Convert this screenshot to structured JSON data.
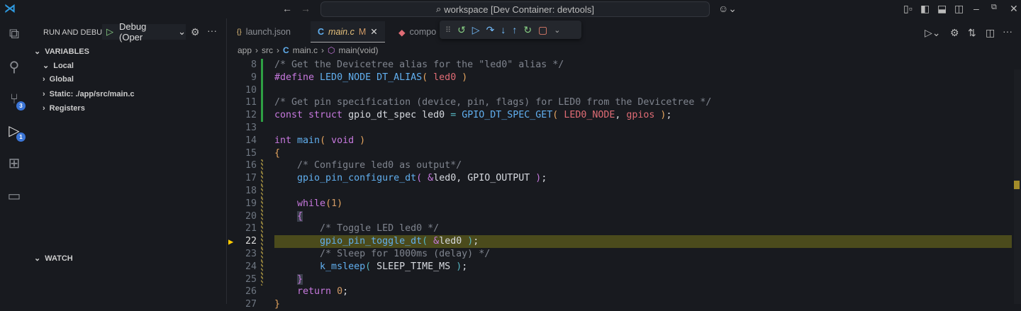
{
  "titlebar": {
    "search_text": "workspace [Dev Container: devtools]",
    "accent": "#2f9ae0"
  },
  "activity": {
    "scm_badge": "3",
    "debug_badge": "1"
  },
  "sidebar": {
    "title": "RUN AND DEBUG",
    "config": "Debug (Oper",
    "variables_label": "VARIABLES",
    "items": [
      {
        "label": "Local",
        "expanded": true
      },
      {
        "label": "Global"
      },
      {
        "label": "Static: ./app/src/main.c"
      },
      {
        "label": "Registers"
      }
    ],
    "watch_label": "WATCH"
  },
  "tabs": [
    {
      "label": "launch.json",
      "icon": "{}"
    },
    {
      "label": "main.c",
      "icon": "C",
      "modified": "M",
      "active": true
    },
    {
      "label": "compo",
      "icon": "docker"
    }
  ],
  "breadcrumb": [
    "app",
    "src",
    "main.c",
    "main(void)"
  ],
  "code": {
    "current_line": 22,
    "lines": [
      {
        "n": "8",
        "t": [
          [
            "cm",
            "/* Get the Devicetree alias for the \"led0\" alias */"
          ]
        ]
      },
      {
        "n": "9",
        "t": [
          [
            "pp",
            "#define "
          ],
          [
            "mac",
            "LED0_NODE DT_ALIAS"
          ],
          [
            "par",
            "( "
          ],
          [
            "arg",
            "led0"
          ],
          [
            "par",
            " )"
          ]
        ]
      },
      {
        "n": "10",
        "t": []
      },
      {
        "n": "11",
        "t": [
          [
            "cm",
            "/* Get pin specification (device, pin, flags) for LED0 from the Devicetree */"
          ]
        ]
      },
      {
        "n": "12",
        "t": [
          [
            "kw",
            "const struct "
          ],
          [
            "id",
            "gpio_dt_spec led0 "
          ],
          [
            "op",
            "= "
          ],
          [
            "mac",
            "GPIO_DT_SPEC_GET"
          ],
          [
            "par",
            "( "
          ],
          [
            "arg",
            "LED0_NODE"
          ],
          [
            "pn",
            ", "
          ],
          [
            "arg",
            "gpios"
          ],
          [
            "par",
            " )"
          ],
          [
            "pn",
            ";"
          ]
        ]
      },
      {
        "n": "13",
        "t": []
      },
      {
        "n": "14",
        "t": [
          [
            "kw",
            "int "
          ],
          [
            "fn",
            "main"
          ],
          [
            "par",
            "( "
          ],
          [
            "kw",
            "void"
          ],
          [
            "par",
            " )"
          ]
        ]
      },
      {
        "n": "15",
        "t": [
          [
            "par",
            "{"
          ]
        ]
      },
      {
        "n": "16",
        "t": [
          [
            "pn",
            "    "
          ],
          [
            "cm",
            "/* Configure led0 as output*/"
          ]
        ]
      },
      {
        "n": "17",
        "t": [
          [
            "pn",
            "    "
          ],
          [
            "fn",
            "gpio_pin_configure_dt"
          ],
          [
            "kw",
            "( "
          ],
          [
            "amp",
            "&"
          ],
          [
            "id",
            "led0, GPIO_OUTPUT "
          ],
          [
            "kw",
            ")"
          ],
          [
            "pn",
            ";"
          ]
        ]
      },
      {
        "n": "18",
        "t": []
      },
      {
        "n": "19",
        "t": [
          [
            "pn",
            "    "
          ],
          [
            "kw",
            "while"
          ],
          [
            "par",
            "("
          ],
          [
            "num",
            "1"
          ],
          [
            "par",
            ")"
          ]
        ]
      },
      {
        "n": "20",
        "t": [
          [
            "pn",
            "    "
          ],
          [
            "br",
            "{"
          ]
        ]
      },
      {
        "n": "21",
        "t": [
          [
            "pn",
            "        "
          ],
          [
            "cm",
            "/* Toggle LED led0 */"
          ]
        ]
      },
      {
        "n": "22",
        "t": [
          [
            "pn",
            "        "
          ],
          [
            "fn",
            "gpio_pin_toggle_dt"
          ],
          [
            "op",
            "( "
          ],
          [
            "amp",
            "&"
          ],
          [
            "id",
            "led0 "
          ],
          [
            "op",
            ")"
          ],
          [
            "pn",
            ";"
          ]
        ]
      },
      {
        "n": "23",
        "t": [
          [
            "pn",
            "        "
          ],
          [
            "cm",
            "/* Sleep for 1000ms (delay) */"
          ]
        ]
      },
      {
        "n": "24",
        "t": [
          [
            "pn",
            "        "
          ],
          [
            "fn",
            "k_msleep"
          ],
          [
            "op",
            "( "
          ],
          [
            "id",
            "SLEEP_TIME_MS "
          ],
          [
            "op",
            ")"
          ],
          [
            "pn",
            ";"
          ]
        ]
      },
      {
        "n": "25",
        "t": [
          [
            "pn",
            "    "
          ],
          [
            "br",
            "}"
          ]
        ]
      },
      {
        "n": "26",
        "t": [
          [
            "pn",
            "    "
          ],
          [
            "kw",
            "return "
          ],
          [
            "num",
            "0"
          ],
          [
            "pn",
            ";"
          ]
        ]
      },
      {
        "n": "27",
        "t": [
          [
            "par",
            "}"
          ]
        ]
      }
    ]
  }
}
